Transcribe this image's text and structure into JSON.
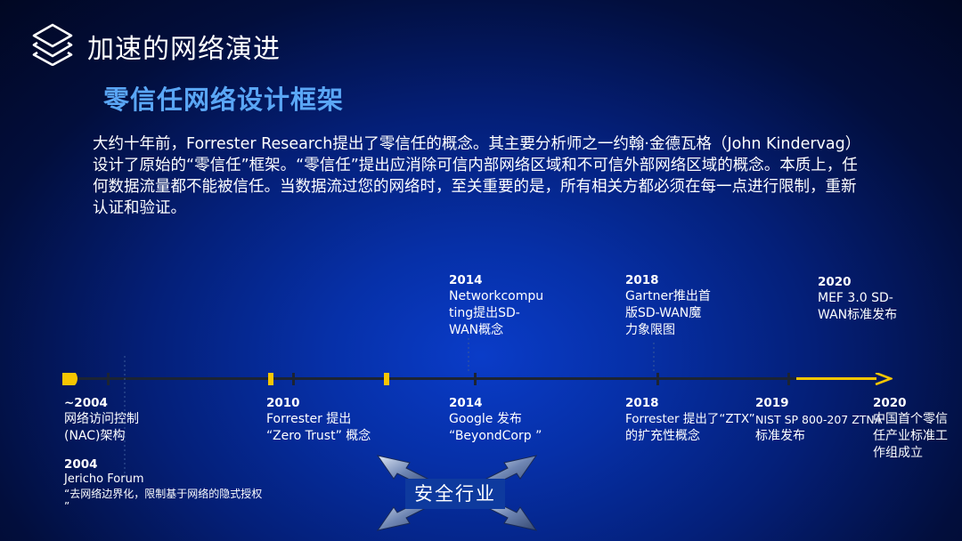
{
  "header": {
    "section_title": "加速的网络演进",
    "slide_title": "零信任网络设计框架"
  },
  "intro_paragraph": "大约十年前，Forrester Research提出了零信任的概念。其主要分析师之一约翰·金德瓦格（John Kindervag）设计了原始的“零信任”框架。“零信任”提出应消除可信内部网络区域和不可信外部网络区域的概念。本质上，任何数据流量都不能被信任。当数据流过您的网络时，至关重要的是，所有相关方都必须在每一点进行限制，重新认证和验证。",
  "timeline_above": [
    {
      "year": "2014",
      "lines": [
        "Networkcompu",
        "ting提出SD-",
        "WAN概念"
      ]
    },
    {
      "year": "2018",
      "lines": [
        "Gartner推出首",
        "版SD-WAN魔",
        "力象限图"
      ]
    },
    {
      "year": "2020",
      "lines": [
        "MEF 3.0 SD-",
        "WAN标准发布"
      ]
    }
  ],
  "timeline_below": [
    {
      "year": "~2004",
      "lines": [
        "网络访问控制",
        "(NAC)架构"
      ]
    },
    {
      "year": "2004",
      "lines": [
        "Jericho Forum",
        "“去网络边界化，限制基于网络的隐式授权",
        "”"
      ]
    },
    {
      "year": "2010",
      "lines": [
        "Forrester 提出",
        "“Zero Trust” 概念"
      ]
    },
    {
      "year": "2014",
      "lines": [
        "Google 发布",
        "“BeyondCorp ”"
      ]
    },
    {
      "year": "2018",
      "lines": [
        "Forrester 提出了“ZTX”",
        "的扩充性概念"
      ]
    },
    {
      "year": "2019",
      "lines": [
        "NIST SP 800-207 ZTNA",
        "标准发布"
      ]
    },
    {
      "year": "2020",
      "lines": [
        "中国首个零信",
        "任产业标准工",
        "作组成立"
      ]
    }
  ],
  "industry_label": "安全行业",
  "colors": {
    "accent_yellow": "#f7c600",
    "title_blue": "#5aa6f5",
    "axis_dark": "#1c2433"
  }
}
